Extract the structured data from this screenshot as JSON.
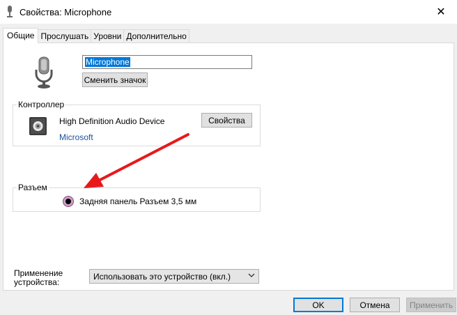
{
  "window": {
    "title": "Свойства: Microphone",
    "close_glyph": "✕"
  },
  "tabs": [
    {
      "label": "Общие",
      "active": true
    },
    {
      "label": "Прослушать",
      "active": false
    },
    {
      "label": "Уровни",
      "active": false
    },
    {
      "label": "Дополнительно",
      "active": false
    }
  ],
  "device": {
    "name_value": "Microphone",
    "change_icon_label": "Сменить значок",
    "icon": "microphone-icon"
  },
  "controller": {
    "group_label": "Контроллер",
    "name": "High Definition Audio Device",
    "vendor": "Microsoft",
    "properties_label": "Свойства",
    "icon": "audio-device-icon"
  },
  "jack": {
    "group_label": "Разъем",
    "description": "Задняя панель Разъем 3,5 мм",
    "jack_color": "#c9a0c4"
  },
  "usage": {
    "label_line1": "Применение",
    "label_line2": "устройства:",
    "selected": "Использовать это устройство (вкл.)"
  },
  "buttons": {
    "ok": "OK",
    "cancel": "Отмена",
    "apply": "Применить"
  },
  "annotation": {
    "arrow_color": "#e8181a"
  }
}
